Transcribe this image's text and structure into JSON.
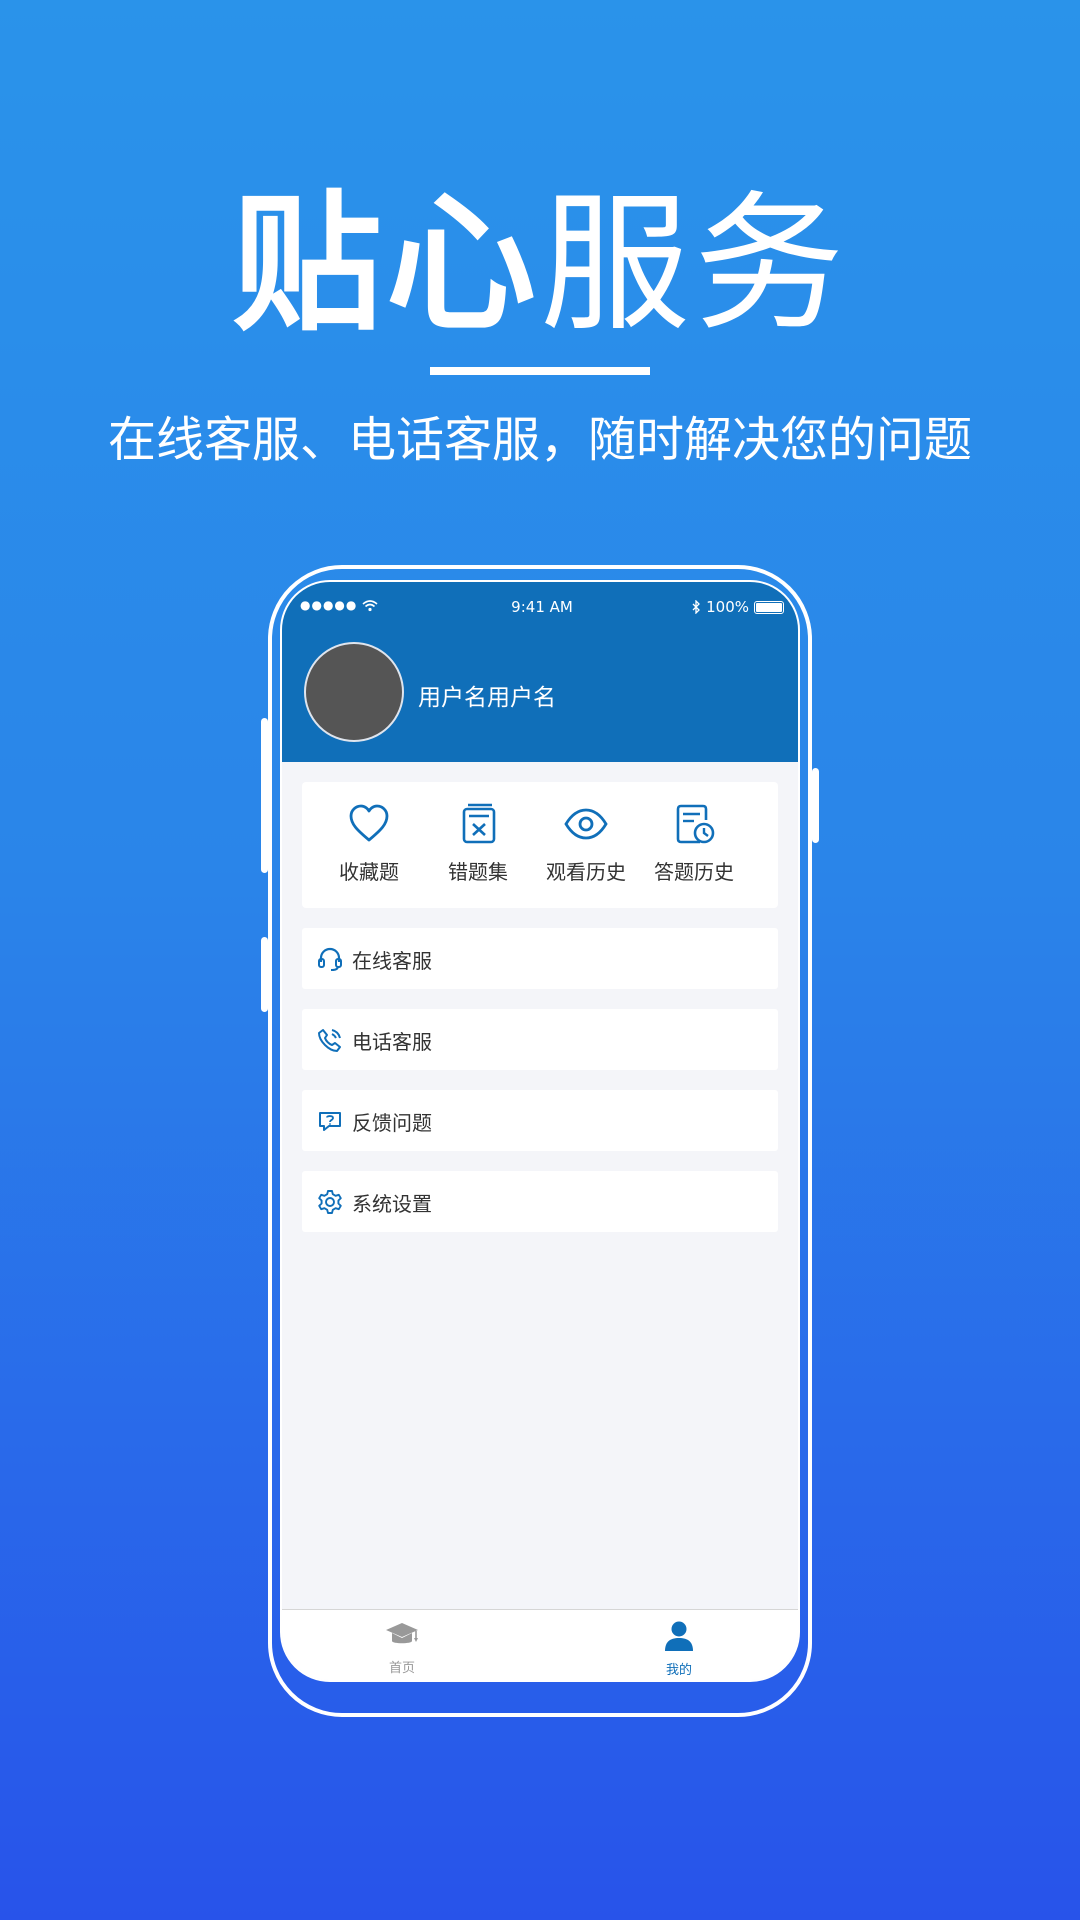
{
  "promo": {
    "title_bold": "贴心",
    "title_light": "服务",
    "subtitle": "在线客服、电话客服，随时解决您的问题"
  },
  "status_bar": {
    "signal": "●●●●● ",
    "time": "9:41 AM",
    "battery": "100%"
  },
  "profile": {
    "username": "用户名用户名"
  },
  "shortcuts": [
    {
      "label": "收藏题",
      "icon": "heart-icon"
    },
    {
      "label": "错题集",
      "icon": "wrong-book-icon"
    },
    {
      "label": "观看历史",
      "icon": "eye-icon"
    },
    {
      "label": "答题历史",
      "icon": "answer-history-icon"
    }
  ],
  "menu": [
    {
      "label": "在线客服",
      "icon": "headset-icon"
    },
    {
      "label": "电话客服",
      "icon": "phone-icon"
    },
    {
      "label": "反馈问题",
      "icon": "feedback-icon"
    },
    {
      "label": "系统设置",
      "icon": "gear-icon"
    }
  ],
  "tabbar": {
    "home": "首页",
    "mine": "我的"
  },
  "colors": {
    "accent": "#106fb9",
    "background_top": "#2a93ea",
    "background_bottom": "#2853ea",
    "tab_inactive": "#999999"
  }
}
